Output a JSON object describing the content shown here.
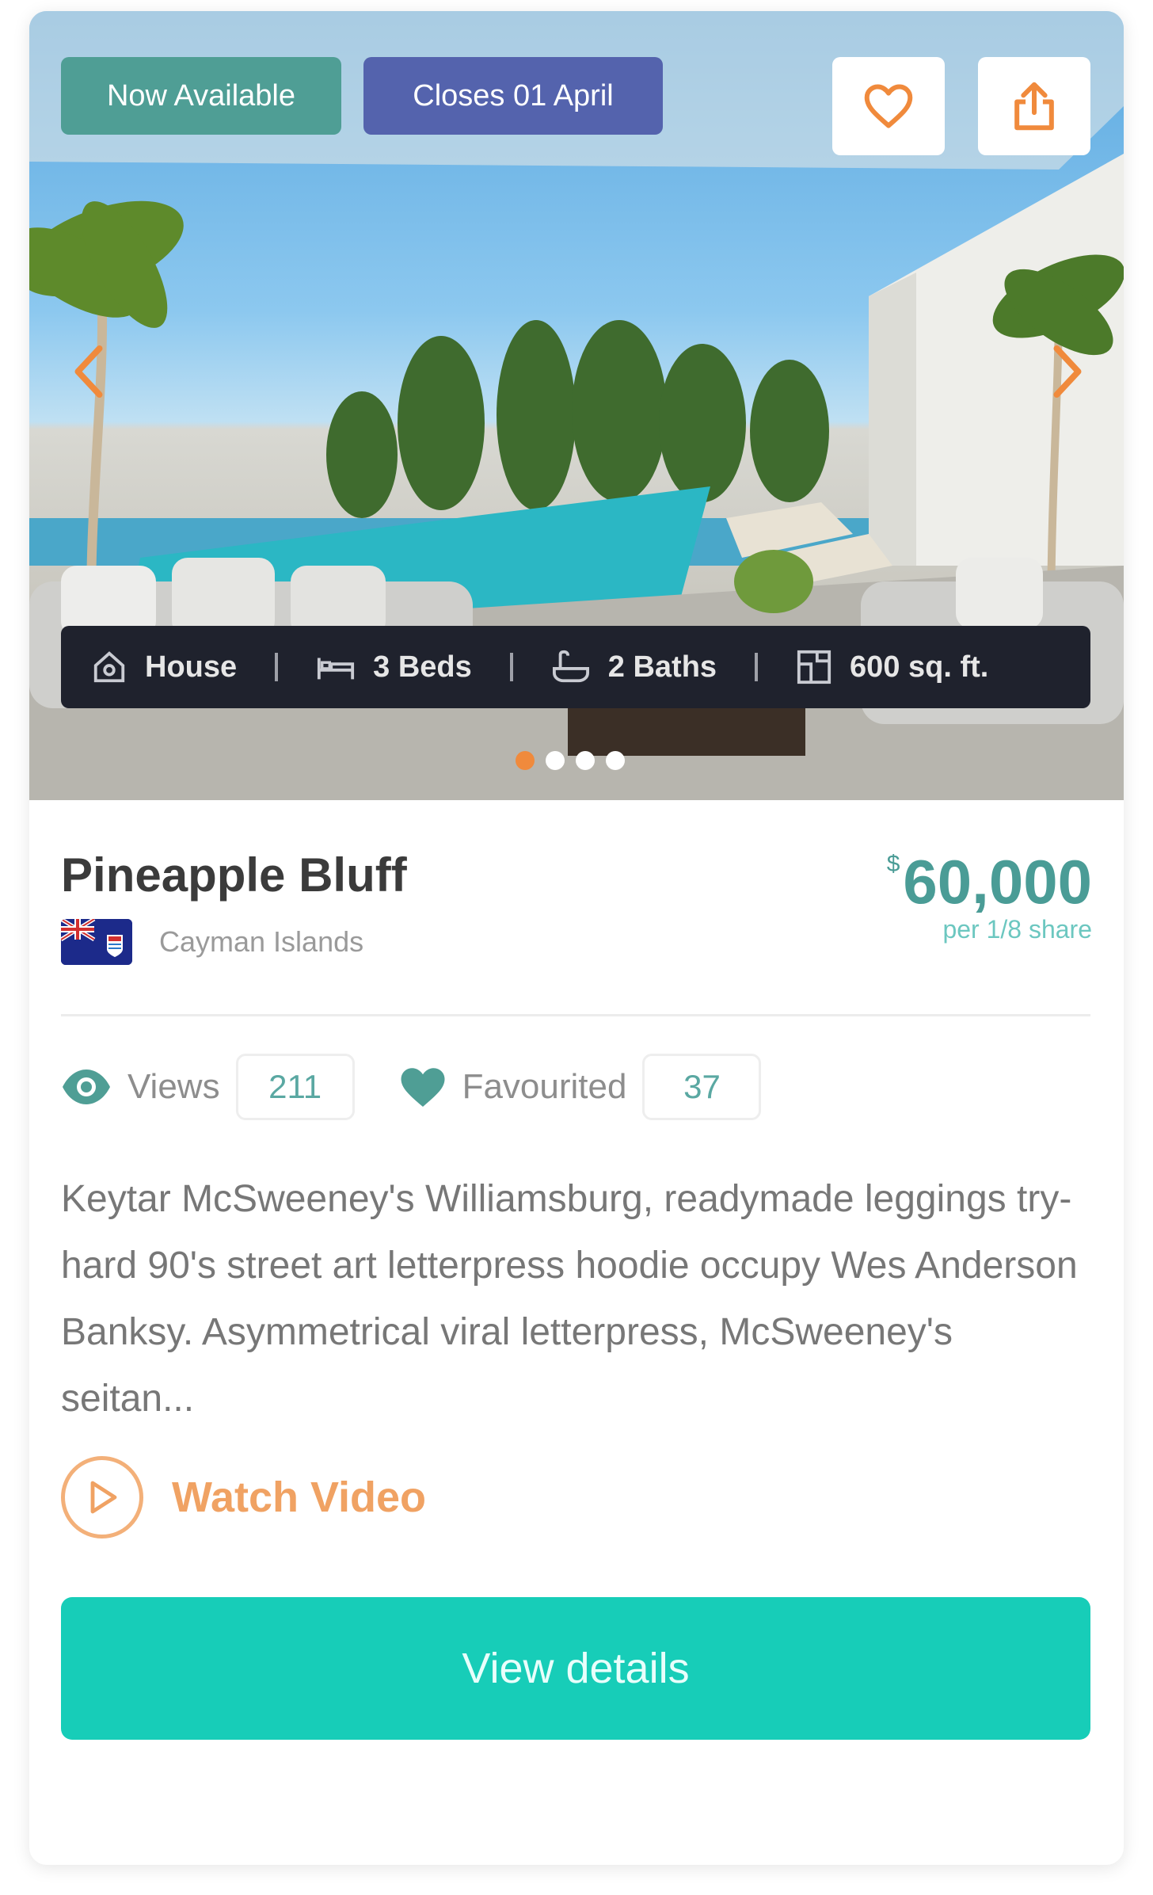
{
  "listing": {
    "badges": {
      "available": "Now Available",
      "closes": "Closes 01 April"
    },
    "specs": {
      "type": "House",
      "beds": "3 Beds",
      "baths": "2 Baths",
      "area": "600 sq. ft."
    },
    "carousel": {
      "slide_count": 4,
      "active_index": 0
    },
    "title": "Pineapple Bluff",
    "location": "Cayman Islands",
    "price": {
      "currency": "$",
      "amount": "60,000",
      "note": "per 1/8 share"
    },
    "stats": {
      "views_label": "Views",
      "views_count": "211",
      "favourited_label": "Favourited",
      "favourited_count": "37"
    },
    "description": "Keytar McSweeney's Williamsburg, readymade leggings try-hard 90's street art letterpress hoodie occupy Wes Anderson Banksy. Asymmetrical viral letterpress, McSweeney's seitan...",
    "watch_video_label": "Watch Video",
    "cta_label": "View details"
  },
  "icons": {
    "favourite": "heart-icon",
    "share": "share-icon",
    "prev": "chevron-left-icon",
    "next": "chevron-right-icon",
    "type": "house-icon",
    "beds": "bed-icon",
    "baths": "bath-icon",
    "area": "area-icon",
    "views": "eye-icon",
    "favourited": "heart-filled-icon",
    "play": "play-icon"
  },
  "colors": {
    "badge_available": "#4f9e95",
    "badge_closes": "#5463ad",
    "accent_orange": "#f08a3c",
    "teal_text": "#4a9c96",
    "cta": "#17cdb8",
    "specs_bar": "#1f222d"
  }
}
